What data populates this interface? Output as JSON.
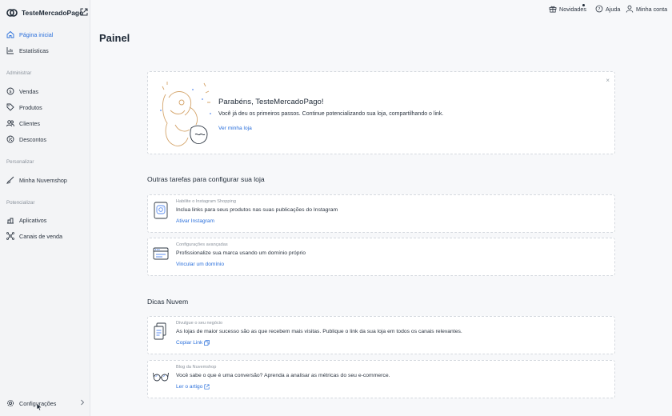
{
  "brand": {
    "name": "TesteMercadoPago"
  },
  "sidebar": {
    "items": [
      {
        "label": "Página inicial",
        "icon": "home-icon"
      },
      {
        "label": "Estatísticas",
        "icon": "chart-icon"
      }
    ],
    "sections": [
      {
        "label": "Administrar",
        "items": [
          {
            "label": "Vendas",
            "icon": "dollar-icon"
          },
          {
            "label": "Produtos",
            "icon": "tag-icon"
          },
          {
            "label": "Clientes",
            "icon": "users-icon"
          },
          {
            "label": "Descontos",
            "icon": "percent-icon"
          }
        ]
      },
      {
        "label": "Personalizar",
        "items": [
          {
            "label": "Minha Nuvemshop",
            "icon": "brush-icon"
          }
        ]
      },
      {
        "label": "Potencializar",
        "items": [
          {
            "label": "Aplicativos",
            "icon": "apps-icon"
          },
          {
            "label": "Canais de venda",
            "icon": "channels-icon"
          }
        ]
      }
    ],
    "settings": {
      "label": "Configurações",
      "icon": "gear-icon"
    }
  },
  "header": {
    "news": "Novidades",
    "help": "Ajuda",
    "account": "Minha conta"
  },
  "page": {
    "title": "Painel"
  },
  "welcome": {
    "title": "Parabéns, TesteMercadoPago!",
    "text": "Você já deu os primeiros passos. Continue potencializando sua loja, compartilhando o link.",
    "link": "Ver minha loja",
    "close": "×"
  },
  "tasks": {
    "title": "Outras tarefas para configurar sua loja",
    "items": [
      {
        "kicker": "Habilite o Instagram Shopping",
        "text": "Inclua links para seus produtos nas suas publicações do Instagram",
        "link": "Ativar Instagram"
      },
      {
        "kicker": "Configurações avançadas",
        "text": "Profissionalize sua marca usando um domínio próprio",
        "link": "Vincular um domínio"
      }
    ]
  },
  "tips": {
    "title": "Dicas Nuvem",
    "items": [
      {
        "kicker": "Divulgue o seu negócio",
        "text": "As lojas de maior sucesso são as que recebem mais visitas. Publique o link da sua loja em todos os canais relevantes.",
        "link": "Copiar Link"
      },
      {
        "kicker": "Blog da Nuvemshop",
        "text": "Você sabe o que é uma conversão? Aprenda a analisar as métricas do seu e-commerce.",
        "link": "Ler o artigo"
      }
    ]
  },
  "colors": {
    "accent": "#2a6fdb",
    "sidebar_bg": "#f3f4f6",
    "page_bg": "#f7f8fa"
  }
}
